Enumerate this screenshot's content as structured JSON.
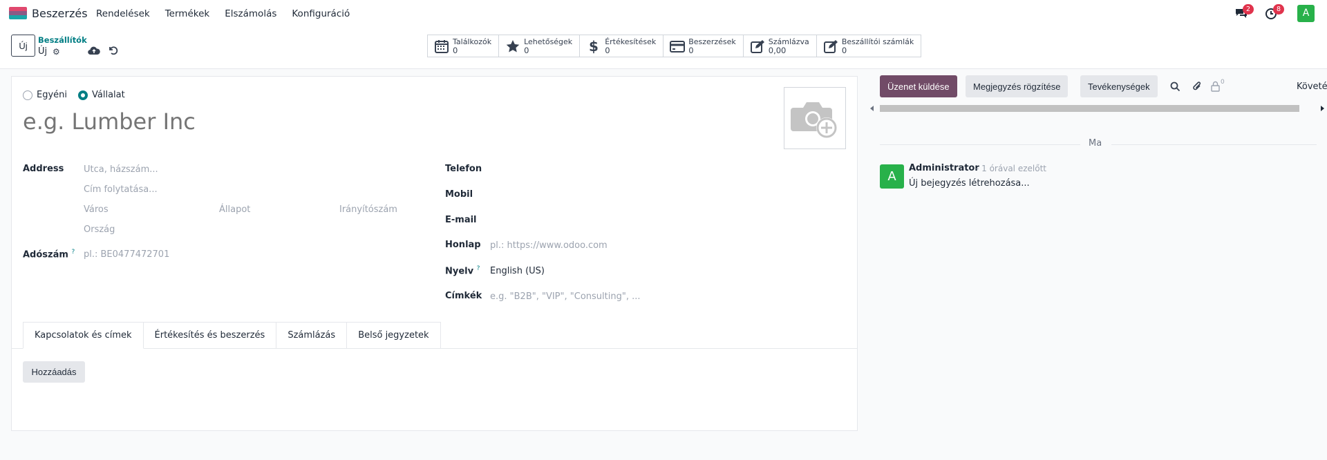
{
  "topbar": {
    "app_name": "Beszerzés",
    "menu": [
      "Rendelések",
      "Termékek",
      "Elszámolás",
      "Konfiguráció"
    ],
    "messages_count": "2",
    "activities_count": "8",
    "user_initial": "A"
  },
  "control": {
    "new_label": "Új",
    "breadcrumb": "Beszállítók",
    "record_name": "Új"
  },
  "smart_buttons": [
    {
      "label": "Találkozók",
      "value": "0",
      "icon": "calendar-icon"
    },
    {
      "label": "Lehetőségek",
      "value": "0",
      "icon": "star-icon"
    },
    {
      "label": "Értékesítések",
      "value": "0",
      "icon": "dollar-icon"
    },
    {
      "label": "Beszerzések",
      "value": "0",
      "icon": "credit-card-icon"
    },
    {
      "label": "Számlázva",
      "value": "0,00",
      "icon": "edit-icon"
    },
    {
      "label": "Beszállítói számlák",
      "value": "0",
      "icon": "edit-icon"
    }
  ],
  "form": {
    "radio_individual": "Egyéni",
    "radio_company": "Vállalat",
    "name_placeholder": "e.g. Lumber Inc",
    "address_label": "Address",
    "street_placeholder": "Utca, házszám...",
    "street2_placeholder": "Cím folytatása...",
    "city_placeholder": "Város",
    "state_placeholder": "Állapot",
    "zip_placeholder": "Irányítószám",
    "country_placeholder": "Ország",
    "vat_label": "Adószám",
    "vat_help": "?",
    "vat_placeholder": "pl.: BE0477472701",
    "phone_label": "Telefon",
    "mobile_label": "Mobil",
    "email_label": "E-mail",
    "website_label": "Honlap",
    "website_placeholder": "pl.: https://www.odoo.com",
    "lang_label": "Nyelv",
    "lang_help": "?",
    "lang_value": "English (US)",
    "tags_label": "Címkék",
    "tags_placeholder": "e.g. \"B2B\", \"VIP\", \"Consulting\", ..."
  },
  "tabs": [
    "Kapcsolatok és címek",
    "Értékesítés és beszerzés",
    "Számlázás",
    "Belső jegyzetek"
  ],
  "add_button": "Hozzáadás",
  "chatter": {
    "send_message": "Üzenet küldése",
    "log_note": "Megjegyzés rögzítése",
    "activities": "Tevékenységek",
    "followers_count": "0",
    "follow": "Követés",
    "date_separator": "Ma",
    "author": "Administrator",
    "time": "- 1 órával ezelőtt",
    "body": "Új bejegyzés létrehozása...",
    "author_initial": "A"
  },
  "colors": {
    "primary": "#714b67",
    "accent": "#017e84",
    "badge": "#e0334c",
    "avatar": "#28b14a"
  }
}
